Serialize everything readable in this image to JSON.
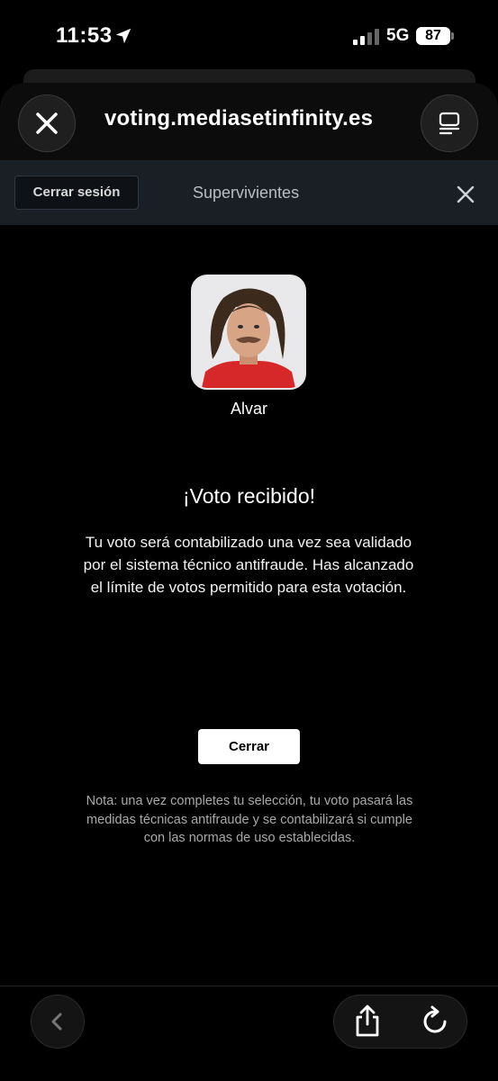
{
  "status_bar": {
    "time": "11:53",
    "network": "5G",
    "battery": "87"
  },
  "browser": {
    "url": "voting.mediasetinfinity.es"
  },
  "header": {
    "logout_label": "Cerrar sesión",
    "section_title": "Supervivientes"
  },
  "candidate": {
    "name": "Alvar"
  },
  "confirmation": {
    "title": "¡Voto recibido!",
    "message": "Tu voto será contabilizado una vez sea validado por el sistema técnico antifraude. Has alcanzado el límite de votos permitido para esta votación.",
    "close_label": "Cerrar",
    "note": "Nota: una vez completes tu selección, tu voto pasará las medidas técnicas antifraude y se contabilizará si cumple con las normas de uso establecidas."
  },
  "icons": {
    "location": "location-arrow-icon",
    "signal": "cellular-signal-icon",
    "close": "close-icon",
    "tabs": "tabs-icon",
    "back": "chevron-left-icon",
    "share": "share-icon",
    "reload": "reload-icon"
  },
  "colors": {
    "background": "#000000",
    "subheader": "#1a1f26",
    "button": "#ffffff",
    "shirt": "#d62828"
  }
}
